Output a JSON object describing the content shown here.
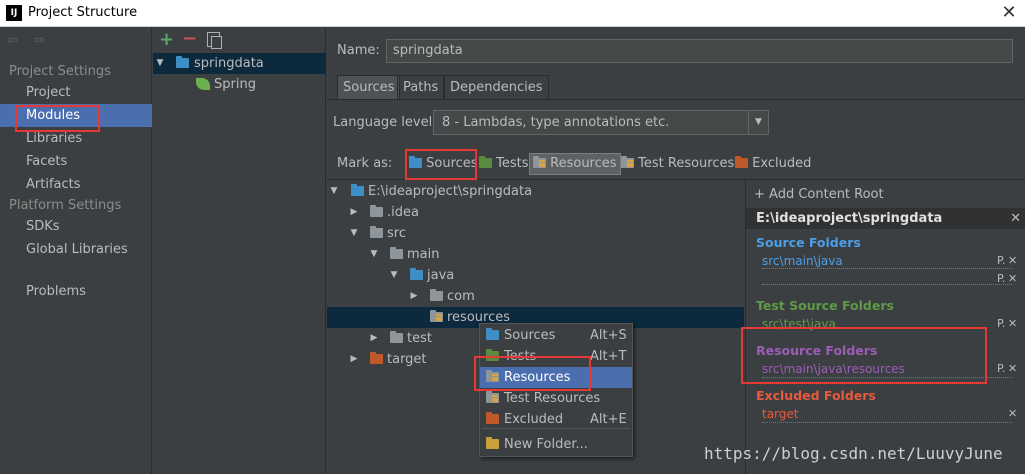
{
  "window": {
    "title": "Project Structure",
    "app_icon": "IJ",
    "close_glyph": "✕"
  },
  "nav": {
    "back_forward": "⇦ ⇨",
    "section_project": "Project Settings",
    "section_platform": "Platform Settings",
    "items": [
      "Project",
      "Modules",
      "Libraries",
      "Facets",
      "Artifacts",
      "SDKs",
      "Global Libraries",
      "Problems"
    ],
    "selected": "Modules"
  },
  "modules": {
    "toolbar": {
      "add": "+",
      "remove": "−"
    },
    "tree": [
      {
        "label": "springdata",
        "expanded": "▼"
      },
      {
        "label": "Spring"
      }
    ]
  },
  "main": {
    "name_label": "Name:",
    "name_value": "springdata",
    "tabs": [
      "Sources",
      "Paths",
      "Dependencies"
    ],
    "language_label": "Language level:",
    "language_value": "8 - Lambdas, type annotations etc.",
    "mark_as_label": "Mark as:",
    "mark_buttons": [
      "Sources",
      "Tests",
      "Resources",
      "Test Resources",
      "Excluded"
    ]
  },
  "file_tree": [
    {
      "label": "E:\\ideaproject\\springdata",
      "toggle": "▼"
    },
    {
      "label": ".idea",
      "toggle": "▶"
    },
    {
      "label": "src",
      "toggle": "▼"
    },
    {
      "label": "main",
      "toggle": "▼"
    },
    {
      "label": "java",
      "toggle": "▼"
    },
    {
      "label": "com",
      "toggle": "▶"
    },
    {
      "label": "resources",
      "toggle": ""
    },
    {
      "label": "test",
      "toggle": "▶"
    },
    {
      "label": "target",
      "toggle": "▶"
    }
  ],
  "popup": {
    "items": [
      {
        "label": "Sources",
        "shortcut": "Alt+S"
      },
      {
        "label": "Tests",
        "shortcut": "Alt+T"
      },
      {
        "label": "Resources",
        "shortcut": ""
      },
      {
        "label": "Test Resources",
        "shortcut": ""
      },
      {
        "label": "Excluded",
        "shortcut": "Alt+E"
      },
      {
        "label": "New Folder...",
        "shortcut": ""
      }
    ]
  },
  "content_root": {
    "add_label": "+ Add Content Root",
    "path": "E:\\ideaproject\\springdata",
    "source_title": "Source Folders",
    "source_item": "src\\main\\java",
    "test_title": "Test Source Folders",
    "test_item": "src\\test\\java",
    "resource_title": "Resource Folders",
    "resource_item": "src\\main\\java\\resources",
    "excluded_title": "Excluded Folders",
    "excluded_item": "target",
    "p_glyph": "P.",
    "x_glyph": "✕"
  },
  "colors": {
    "source": "#4a9fe8",
    "test": "#5e9a48",
    "resource": "#9c5db7",
    "excluded": "#e8593d",
    "highlight": "#e53935"
  },
  "watermark": "https://blog.csdn.net/LuuvyJune"
}
